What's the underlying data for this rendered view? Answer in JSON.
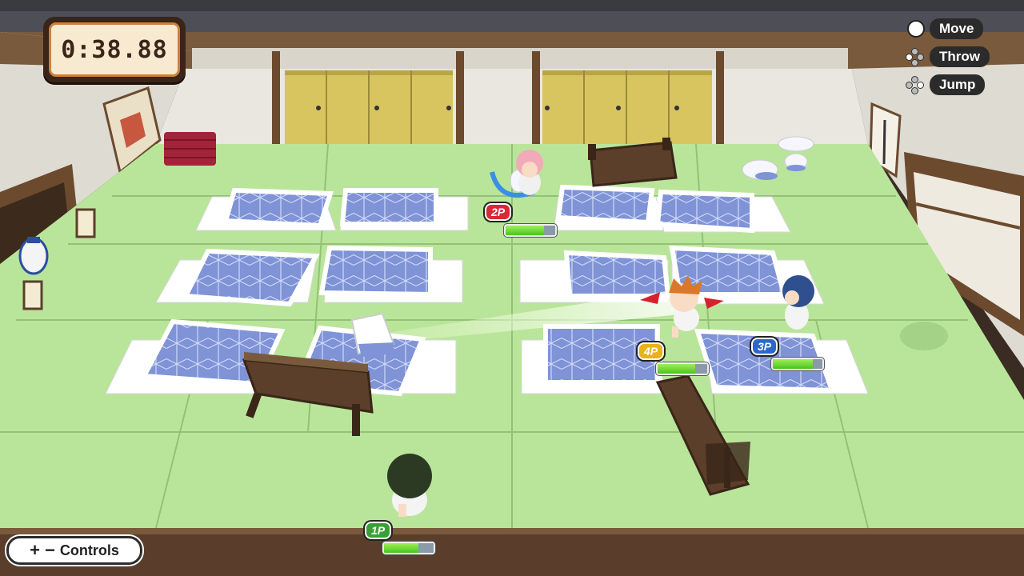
{
  "timer": {
    "value": "0:38.88"
  },
  "controls_hints": [
    {
      "label": "Move",
      "icon": "analog-stick-icon"
    },
    {
      "label": "Throw",
      "icon": "dpad-button-icon"
    },
    {
      "label": "Jump",
      "icon": "dpad-button-icon"
    }
  ],
  "controls_button": {
    "plus": "+",
    "minus": "−",
    "label": "Controls"
  },
  "players": [
    {
      "id": "1P",
      "color": "#3aa036",
      "health": 0.7
    },
    {
      "id": "2P",
      "color": "#d8283a",
      "health": 0.78
    },
    {
      "id": "3P",
      "color": "#2c67c8",
      "health": 0.8
    },
    {
      "id": "4P",
      "color": "#e8b21c",
      "health": 0.75
    }
  ],
  "colors": {
    "tatami": "#b9e59a",
    "futon": "#7f93d6",
    "wood": "#5b3f2a"
  }
}
